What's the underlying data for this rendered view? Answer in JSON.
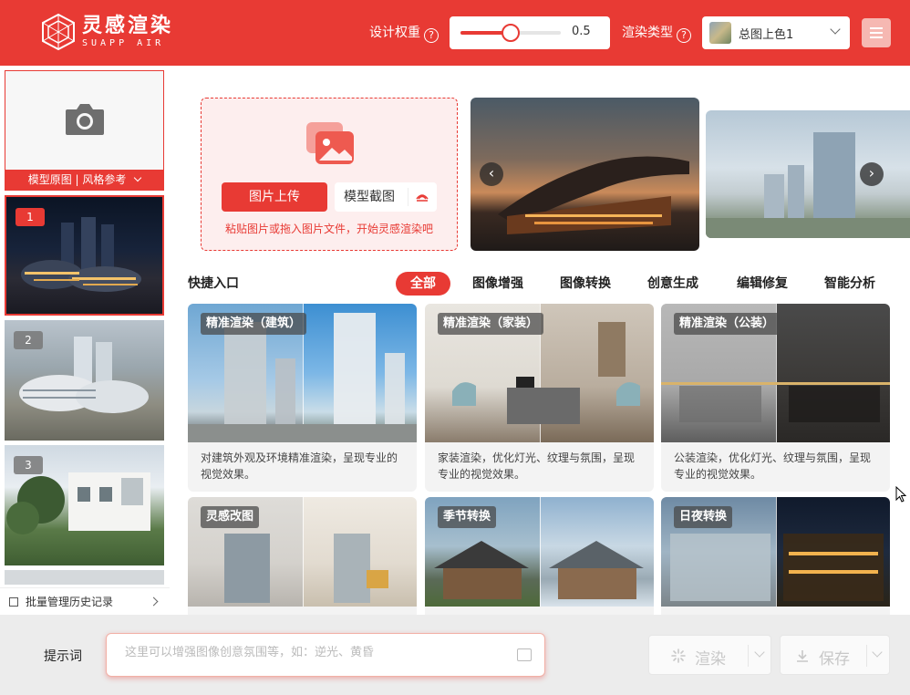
{
  "header": {
    "logo_cn": "灵感渲染",
    "logo_en": "SUAPP AIR",
    "weight_label": "设计权重",
    "weight_value": "0.5",
    "weight_fraction": 0.5,
    "render_type_label": "渲染类型",
    "render_type_value": "总图上色1",
    "help_glyph": "?"
  },
  "sidebar": {
    "reference_label": "模型原图 | 风格参考",
    "history": [
      {
        "index": "1"
      },
      {
        "index": "2"
      },
      {
        "index": "3"
      }
    ],
    "batch_label": "批量管理历史记录"
  },
  "upload": {
    "upload_button": "图片上传",
    "screenshot_button": "模型截图",
    "hint": "粘贴图片或拖入图片文件，开始灵感渲染吧"
  },
  "quick": {
    "title": "快捷入口",
    "tabs": [
      "全部",
      "图像增强",
      "图像转换",
      "创意生成",
      "编辑修复",
      "智能分析"
    ],
    "active_tab": "全部"
  },
  "cards": [
    {
      "title": "精准渲染（建筑）",
      "desc": "对建筑外观及环境精准渲染，呈现专业的视觉效果。"
    },
    {
      "title": "精准渲染（家装）",
      "desc": "家装渲染，优化灯光、纹理与氛围，呈现专业的视觉效果。"
    },
    {
      "title": "精准渲染（公装）",
      "desc": "公装渲染，优化灯光、纹理与氛围，呈现专业的视觉效果。"
    },
    {
      "title": "灵感改图",
      "desc": ""
    },
    {
      "title": "季节转换",
      "desc": ""
    },
    {
      "title": "日夜转换",
      "desc": ""
    }
  ],
  "bottom": {
    "prompt_label": "提示词",
    "prompt_placeholder": "这里可以增强图像创意氛围等，如：逆光、黄昏",
    "render_button": "渲染",
    "save_button": "保存"
  },
  "colors": {
    "brand": "#e83a34"
  }
}
